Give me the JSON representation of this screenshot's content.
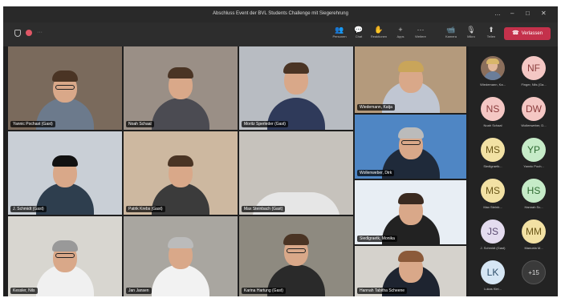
{
  "window": {
    "title": "Abschluss Event der BVL Students Challenge mit Siegerehrung",
    "controls": [
      "…",
      "–",
      "□",
      "✕"
    ]
  },
  "toolbar": {
    "buttons": [
      {
        "label": "Personen",
        "icon": "people-icon",
        "glyph": "👥"
      },
      {
        "label": "Chat",
        "icon": "chat-icon",
        "glyph": "💬"
      },
      {
        "label": "Reaktionen",
        "icon": "reactions-icon",
        "glyph": "✋"
      },
      {
        "label": "Apps",
        "icon": "apps-icon",
        "glyph": "+"
      },
      {
        "label": "Weitere",
        "icon": "more-icon",
        "glyph": "···"
      },
      {
        "label": "Kamera",
        "icon": "camera-icon",
        "glyph": "📹"
      },
      {
        "label": "Mikro",
        "icon": "mic-icon",
        "glyph": "🎙"
      },
      {
        "label": "Teilen",
        "icon": "share-icon",
        "glyph": "⬆"
      }
    ],
    "leave_label": "Verlassen",
    "leave_color": "#c4314b"
  },
  "tiles": [
    {
      "name": "Yannic Pochast (Gast)",
      "bg": "#7a6a5c"
    },
    {
      "name": "Noah Schaal",
      "bg": "#9a8f86"
    },
    {
      "name": "Moritz Sperleder (Gast)",
      "bg": "#b8bcc2"
    },
    {
      "name": "Wiedemann, Katja",
      "bg": "#b49a7c"
    },
    {
      "name": "J. Schmidt (Gast)",
      "bg": "#c9cfd6"
    },
    {
      "name": "Patrik Krebs (Gast)",
      "bg": "#cdb8a0"
    },
    {
      "name": "Max Steinbach (Gast)",
      "bg": "#c6c2bc"
    },
    {
      "name": "Wollenweber, Dirk",
      "bg": "#4f86c4"
    },
    {
      "name": "Siedlgraetk, Monika",
      "bg": "#e8eef4"
    },
    {
      "name": "Kessler, Nils",
      "bg": "#d8d6d0"
    },
    {
      "name": "Jan Jansen",
      "bg": "#a9a6a0"
    },
    {
      "name": "Karina Hartung (Gast)",
      "bg": "#8e8a80"
    },
    {
      "name": "Hannah Tabitha Scheene",
      "bg": "#d5d2cc"
    }
  ],
  "participants": [
    {
      "initials": "",
      "name": "Wiedemann, Ka...",
      "bg": "#8b6f5c",
      "fg": "#ffffff",
      "photo": true
    },
    {
      "initials": "NF",
      "name": "Finger, Nils (Ga...",
      "bg": "#f4c7c4",
      "fg": "#8a3b3b"
    },
    {
      "initials": "NS",
      "name": "Noah Schaal",
      "bg": "#f4c7c4",
      "fg": "#8a3b3b"
    },
    {
      "initials": "DW",
      "name": "Wollenweber, D...",
      "bg": "#f4c7c4",
      "fg": "#8a3b3b"
    },
    {
      "initials": "MS",
      "name": "Siedlgraetk...",
      "bg": "#f2e1a4",
      "fg": "#6a5618"
    },
    {
      "initials": "YP",
      "name": "Yannic Poch...",
      "bg": "#c6ebc8",
      "fg": "#2f6b33"
    },
    {
      "initials": "MS",
      "name": "Max Steinb...",
      "bg": "#f2e1a4",
      "fg": "#6a5618"
    },
    {
      "initials": "HS",
      "name": "Hannah Sc...",
      "bg": "#c6ebc8",
      "fg": "#2f6b33"
    },
    {
      "initials": "JS",
      "name": "J. Schmidt (Gast)",
      "bg": "#e4dcef",
      "fg": "#5a4a70"
    },
    {
      "initials": "MM",
      "name": "Manuela M...",
      "bg": "#f2e1a4",
      "fg": "#6a5618"
    },
    {
      "initials": "LK",
      "name": "Lukas Klei...",
      "bg": "#d6e6f4",
      "fg": "#2f4f6b"
    }
  ],
  "more_count": "+15"
}
